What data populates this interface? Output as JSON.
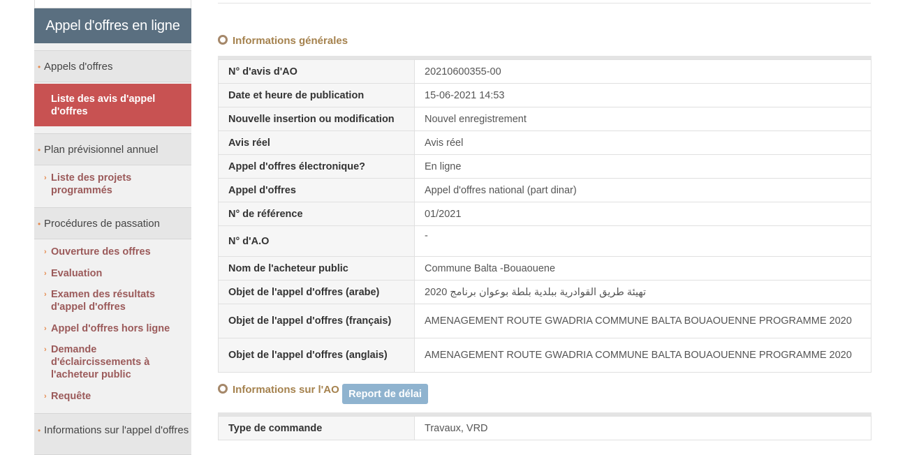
{
  "sidebar": {
    "title": "Appel d'offres en ligne",
    "sections": [
      {
        "label": "Appels d'offres"
      },
      {
        "label": "Plan prévisionnel annuel"
      },
      {
        "label": "Procédures de passation"
      },
      {
        "label": "Informations sur l'appel d'offres"
      }
    ],
    "active_item": "Liste des avis d'appel d'offres",
    "plan_items": [
      "Liste des projets programmés"
    ],
    "procedure_items": [
      "Ouverture des offres",
      "Evaluation",
      "Examen des résultats d'appel d'offres",
      "Appel d'offres hors ligne",
      "Demande d'éclaircissements à l'acheteur public",
      "Requête"
    ]
  },
  "main": {
    "general_title": "Informations générales",
    "general_rows": [
      {
        "label": "N° d'avis d'AO",
        "value": "20210600355-00"
      },
      {
        "label": "Date et heure de publication",
        "value": "15-06-2021 14:53"
      },
      {
        "label": "Nouvelle insertion ou modification",
        "value": "Nouvel enregistrement"
      },
      {
        "label": "Avis réel",
        "value": "Avis réel"
      },
      {
        "label": "Appel d'offres électronique?",
        "value": "En ligne"
      },
      {
        "label": "Appel d'offres",
        "value": "Appel d'offres national (part dinar)"
      },
      {
        "label": "N° de référence",
        "value": "01/2021"
      },
      {
        "label": "N° d'A.O",
        "value": "-"
      },
      {
        "label": "Nom de l'acheteur public",
        "value": "Commune Balta -Bouaouene"
      },
      {
        "label": "Objet de l'appel d'offres (arabe)",
        "value": "تهيئة طريق القوادرية ببلدية بلطة بوعوان برنامج 2020"
      },
      {
        "label": "Objet de l'appel d'offres (français)",
        "value": "AMENAGEMENT ROUTE GWADRIA COMMUNE BALTA BOUAOUENNE PROGRAMME 2020"
      },
      {
        "label": "Objet de l'appel d'offres (anglais)",
        "value": "AMENAGEMENT ROUTE GWADRIA COMMUNE BALTA BOUAOUENNE PROGRAMME 2020"
      }
    ],
    "ao_title": "Informations sur l'AO",
    "report_button": "Report de délai",
    "ao_rows": [
      {
        "label": "Type de commande",
        "value": "Travaux, VRD"
      }
    ]
  },
  "colors": {
    "sidebar_title_bg": "#5a6f80",
    "active_item_bg": "#c85252",
    "section_title": "#a5824e",
    "link": "#9b5a5a",
    "button_bg": "#8fb3cf"
  }
}
